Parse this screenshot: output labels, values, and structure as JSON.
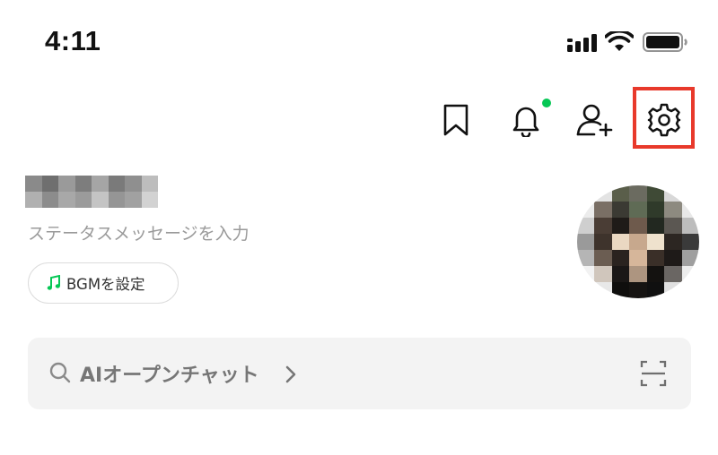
{
  "status_bar": {
    "time": "4:11",
    "icons": [
      "cellular-signal-icon",
      "wifi-icon",
      "battery-icon"
    ]
  },
  "top_actions": {
    "icons": [
      "bookmark-icon",
      "bell-icon",
      "add-friend-icon",
      "settings-icon"
    ],
    "notification_dot_color": "#06c755",
    "highlight_color": "#e8392b"
  },
  "profile": {
    "status_message_placeholder": "ステータスメッセージを入力",
    "bgm_label": "BGMを設定",
    "bgm_icon": "music-note-icon",
    "accent_color": "#06c755"
  },
  "search": {
    "label": "AIオープンチャット",
    "icon": "search-icon",
    "chevron": "chevron-right-icon",
    "scan_icon": "scan-icon"
  }
}
